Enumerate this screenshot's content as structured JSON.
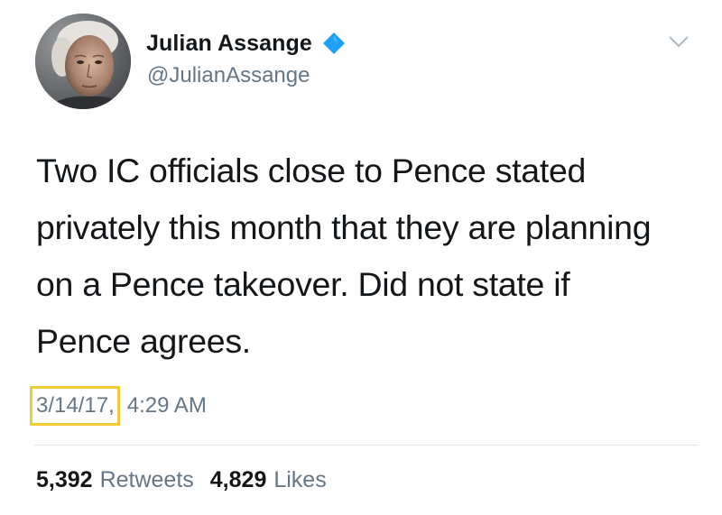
{
  "author": {
    "display_name": "Julian Assange",
    "handle": "@JulianAssange",
    "verified": true,
    "avatar_icon": "profile-photo",
    "verified_icon": "verified-badge-icon",
    "verified_color": "#1da1f2"
  },
  "menu": {
    "icon": "chevron-down-icon"
  },
  "tweet": {
    "text": "Two IC officials close to Pence stated privately this month that they are planning on a Pence takeover. Did not state if Pence agrees.",
    "date": "3/14/17,",
    "time": "4:29 AM",
    "date_highlight_color": "#f2cc35"
  },
  "stats": {
    "retweets_count": "5,392",
    "retweets_label": "Retweets",
    "likes_count": "4,829",
    "likes_label": "Likes"
  },
  "colors": {
    "text_primary": "#14171a",
    "text_secondary": "#657786",
    "divider": "#e1e8ed"
  }
}
